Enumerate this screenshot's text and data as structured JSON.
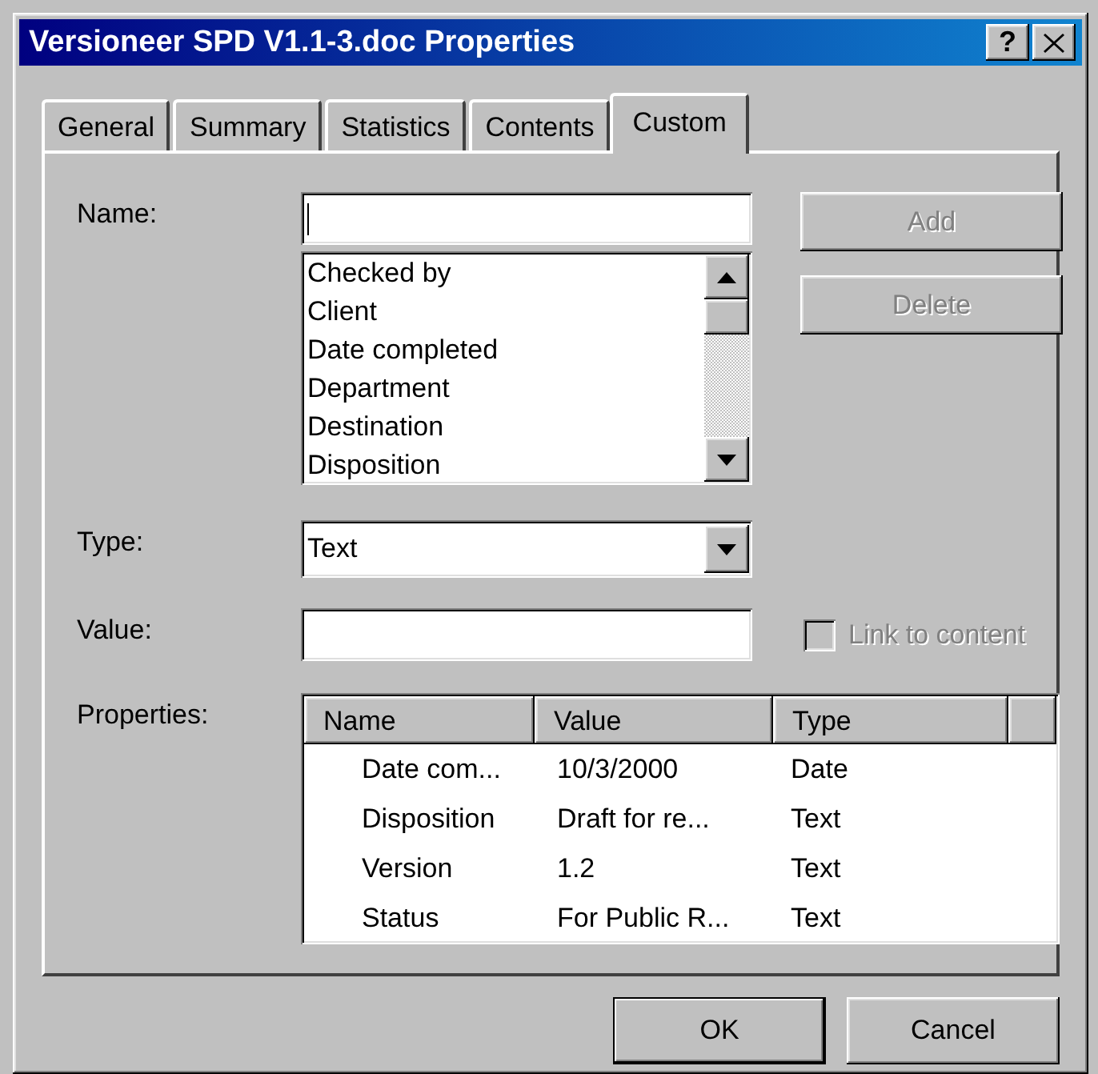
{
  "window": {
    "title": "Versioneer SPD V1.1-3.doc Properties",
    "help_button": "?"
  },
  "tabs": [
    {
      "label": "General",
      "selected": false
    },
    {
      "label": "Summary",
      "selected": false
    },
    {
      "label": "Statistics",
      "selected": false
    },
    {
      "label": "Contents",
      "selected": false
    },
    {
      "label": "Custom",
      "selected": true
    }
  ],
  "name_field": {
    "label": "Name:"
  },
  "name_list": {
    "items": [
      "Checked by",
      "Client",
      "Date completed",
      "Department",
      "Destination",
      "Disposition"
    ]
  },
  "side_buttons": [
    {
      "label": "Add",
      "disabled": true
    },
    {
      "label": "Delete",
      "disabled": true
    }
  ],
  "type_field": {
    "label": "Type:",
    "value": "Text"
  },
  "value_field": {
    "label": "Value:"
  },
  "link_checkbox": {
    "label": "Link to content",
    "checked": false,
    "disabled": true
  },
  "properties": {
    "label": "Properties:",
    "columns": [
      "Name",
      "Value",
      "Type"
    ],
    "rows": [
      [
        "Date com...",
        "10/3/2000",
        "Date"
      ],
      [
        "Disposition",
        "Draft for re...",
        "Text"
      ],
      [
        "Version",
        "1.2",
        "Text"
      ],
      [
        "Status",
        "For Public R...",
        "Text"
      ]
    ]
  },
  "buttons": [
    {
      "label": "OK",
      "default": true
    },
    {
      "label": "Cancel",
      "default": false
    }
  ]
}
